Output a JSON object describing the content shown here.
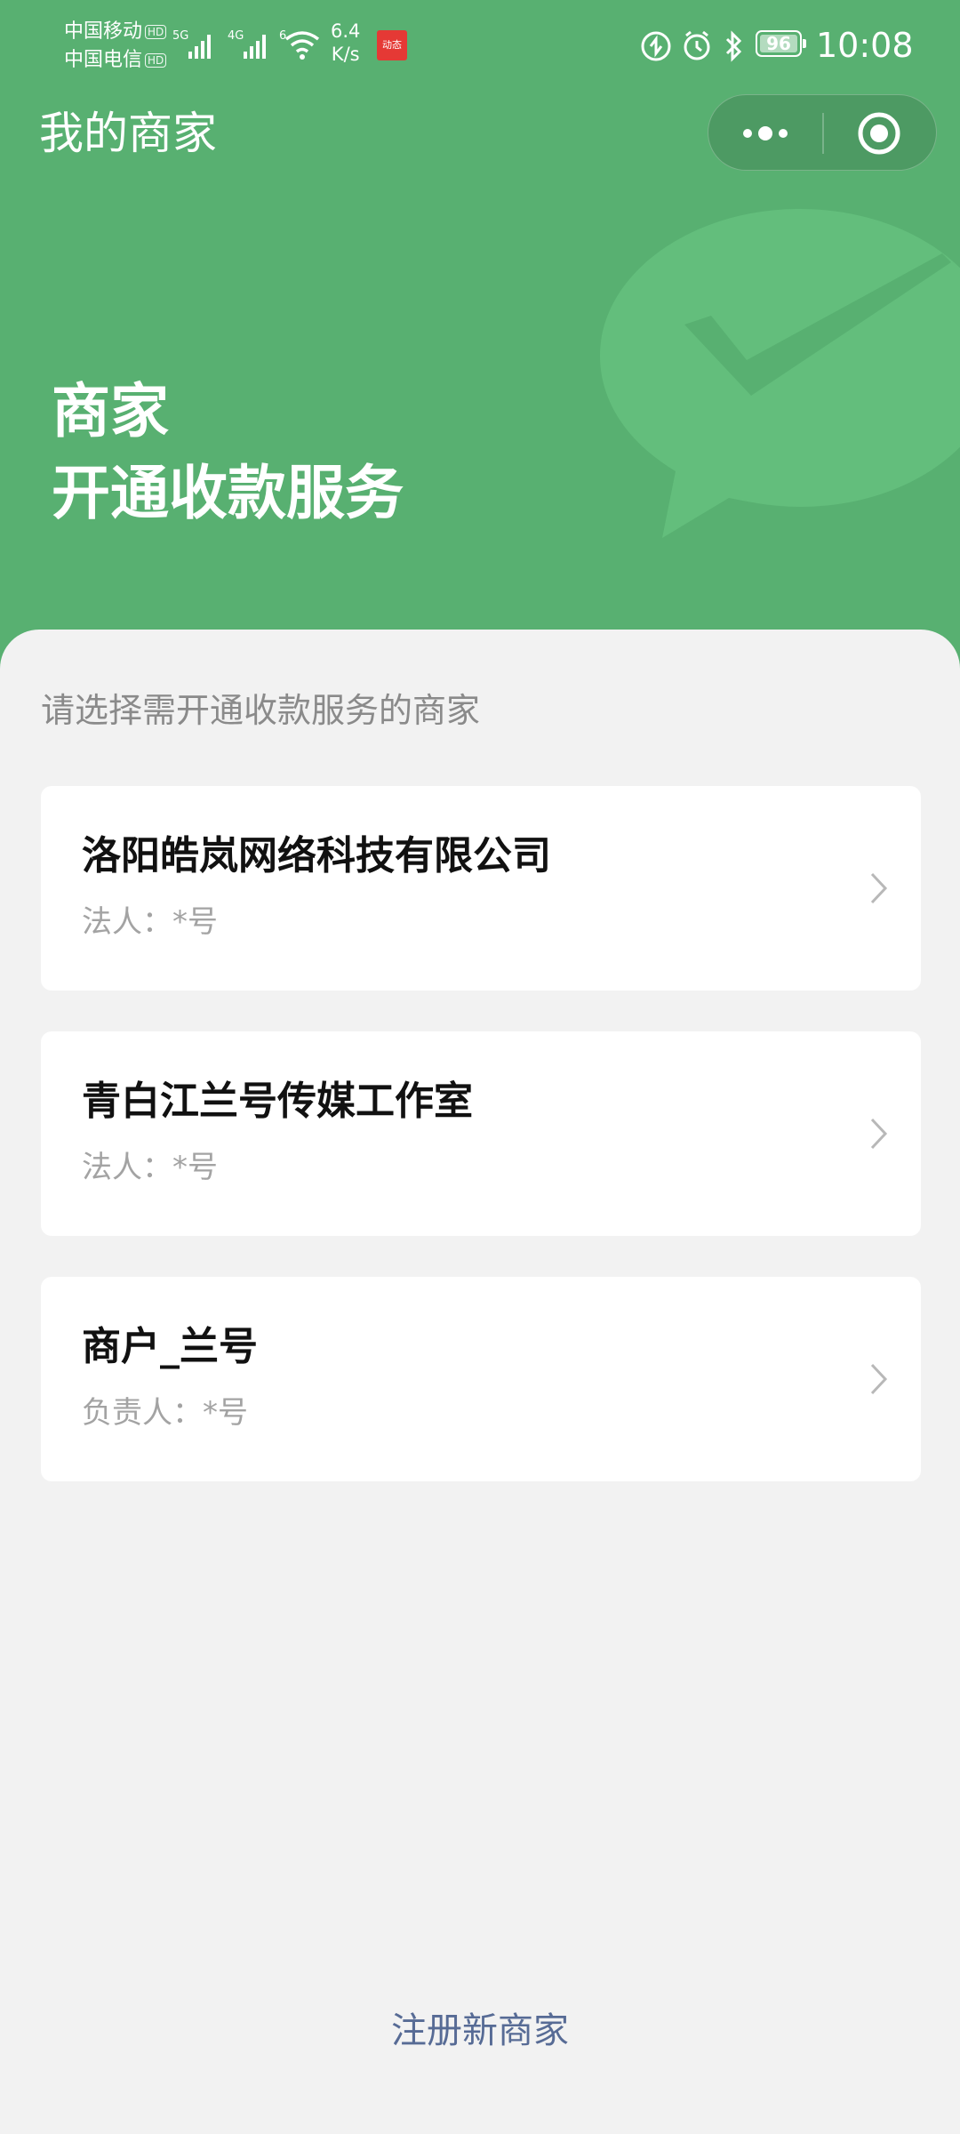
{
  "status_bar": {
    "carrier1": "中国移动",
    "carrier2": "中国电信",
    "hd": "HD",
    "net1": "5G",
    "net2": "4G",
    "wifi_gen": "6",
    "speed_value": "6.4",
    "speed_unit": "K/s",
    "app_badge": "动态",
    "battery_level": "96",
    "time": "10:08"
  },
  "nav": {
    "title": "我的商家"
  },
  "hero": {
    "line1": "商家",
    "line2": "开通收款服务"
  },
  "main": {
    "prompt": "请选择需开通收款服务的商家",
    "merchants": [
      {
        "name": "洛阳皓岚网络科技有限公司",
        "person": "法人：*号"
      },
      {
        "name": "青白江兰号传媒工作室",
        "person": "法人：*号"
      },
      {
        "name": "商户_兰号",
        "person": "负责人：*号"
      }
    ],
    "register_label": "注册新商家"
  },
  "colors": {
    "brand_green": "#58b071",
    "link_blue": "#576b95",
    "background": "#f2f2f2"
  },
  "icons": [
    "more-icon",
    "target-icon",
    "wechat-pay-watermark",
    "chevron-right-icon",
    "alarm-icon",
    "bluetooth-icon",
    "wifi-icon",
    "signal-icon"
  ]
}
